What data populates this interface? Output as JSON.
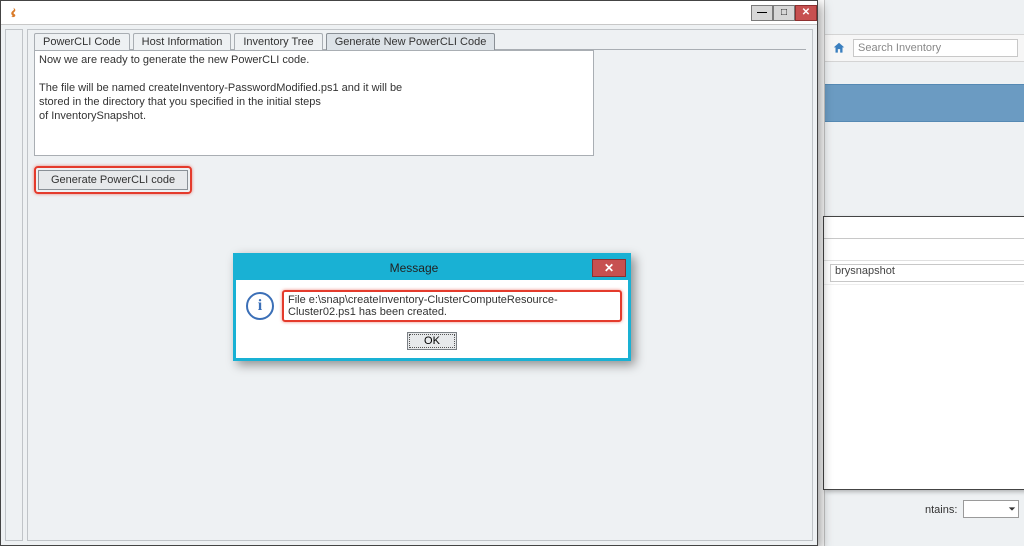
{
  "bg": {
    "search_placeholder": "Search Inventory",
    "footer_label": "ntains:"
  },
  "sub": {
    "search_value": "brysnapshot"
  },
  "main": {
    "tabs": [
      {
        "label": "PowerCLI Code"
      },
      {
        "label": "Host Information"
      },
      {
        "label": "Inventory Tree"
      },
      {
        "label": "Generate New PowerCLI Code"
      }
    ],
    "instructions": "Now we are ready to generate the new PowerCLI code.\n\nThe file will be named createInventory-PasswordModified.ps1 and it will be\nstored in the directory that you specified in the initial steps\nof InventorySnapshot.",
    "generate_btn": "Generate PowerCLI code"
  },
  "modal": {
    "title": "Message",
    "text": "File e:\\snap\\createInventory-ClusterComputeResource-Cluster02.ps1 has been created.",
    "ok": "OK"
  },
  "caption": {
    "min": "—",
    "max": "□",
    "close": "✕"
  }
}
